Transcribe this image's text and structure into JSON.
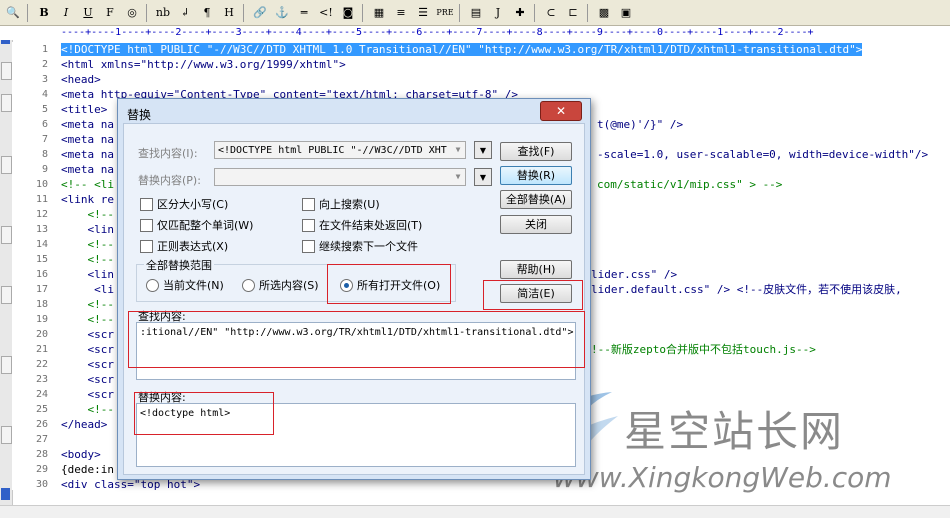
{
  "toolbar": {
    "items": [
      "B",
      "I",
      "U",
      "F",
      "nb",
      "↲",
      "¶",
      "H",
      "PRE",
      "J"
    ]
  },
  "ruler": "----+----1----+----2----+----3----+----4----+----5----+----6----+----7----+----8----+----9----+----0----+----1----+----2----+",
  "line_numbers": [
    "1",
    "2",
    "3",
    "4",
    "5",
    "6",
    "7",
    "8",
    "9",
    "10",
    "11",
    "12",
    "13",
    "14",
    "15",
    "16",
    "17",
    "18",
    "19",
    "20",
    "21",
    "22",
    "23",
    "24",
    "25",
    "26",
    "27",
    "28",
    "29",
    "30"
  ],
  "code": {
    "line1": "<!DOCTYPE html PUBLIC \"-//W3C//DTD XHTML 1.0 Transitional//EN\" \"http://www.w3.org/TR/xhtml1/DTD/xhtml1-transitional.dtd\">",
    "line2": "<html xmlns=\"http://www.w3.org/1999/xhtml\">",
    "line3": "<head>",
    "line4": "<meta http-equiv=\"Content-Type\" content=\"text/html; charset=utf-8\" />",
    "line5": "<title>",
    "line6": "<meta na",
    "line6_right": "t(@me)'/}\" />",
    "line7": "<meta na",
    "line8": "<meta na",
    "line8_right": "-scale=1.0, user-scalable=0, width=device-width\"/>",
    "line9": "<meta na",
    "line10": "<!-- <li",
    "line10_right": "com/static/v1/mip.css\" > -->",
    "line11": "<link re",
    "line12": "    <!--",
    "line13": "    <lin",
    "line14": "    <!--",
    "line15": "    <!--",
    "line16": "    <lin",
    "line16_right": "lider.css\" />",
    "line17": "     <li",
    "line17_right": "lider.default.css\" /> <!--皮肤文件，若不使用该皮肤,",
    "line18": "    <!--",
    "line19": "    <!--",
    "line20": "    <scr",
    "line21": "    <scr",
    "line21_right": "!--新版zepto合并版中不包括touch.js-->",
    "line22": "    <scr",
    "line23": "    <scr",
    "line24": "    <scr",
    "line25": "    <!--",
    "line26": "</head>",
    "line28": "<body>",
    "line29": "{dede:in",
    "line30": "<div class=\"top hot\">"
  },
  "dialog": {
    "title": "替换",
    "close_label": "✕",
    "find_label": "查找内容(I):",
    "find_value": "<!DOCTYPE html PUBLIC \"-//W3C//DTD XHT",
    "replace_label": "替换内容(P):",
    "replace_value": "",
    "buttons": {
      "find": "查找(F)",
      "replace": "替换(R)",
      "replace_all": "全部替换(A)",
      "close": "关闭",
      "help": "帮助(H)",
      "simple": "简洁(E)"
    },
    "options": {
      "match_case": "区分大小写(C)",
      "search_up": "向上搜索(U)",
      "whole_word": "仅匹配整个单词(W)",
      "wrap_at_end": "在文件结束处返回(T)",
      "regex": "正则表达式(X)",
      "next_file": "继续搜索下一个文件"
    },
    "scope": {
      "label": "全部替换范围",
      "current_file": "当前文件(N)",
      "selection": "所选内容(S)",
      "all_open_files": "所有打开文件(O)",
      "selected": "all_open_files"
    },
    "find_panel_label": "查找内容:",
    "find_panel_text": ":itional//EN\" \"http://www.w3.org/TR/xhtml1/DTD/xhtml1-transitional.dtd\">",
    "replace_panel_label": "替换内容:",
    "replace_panel_text": "<!doctype html>"
  },
  "watermark": {
    "name": "星空站长网",
    "url": "www.XingkongWeb.com",
    "logo_letter": "K"
  }
}
